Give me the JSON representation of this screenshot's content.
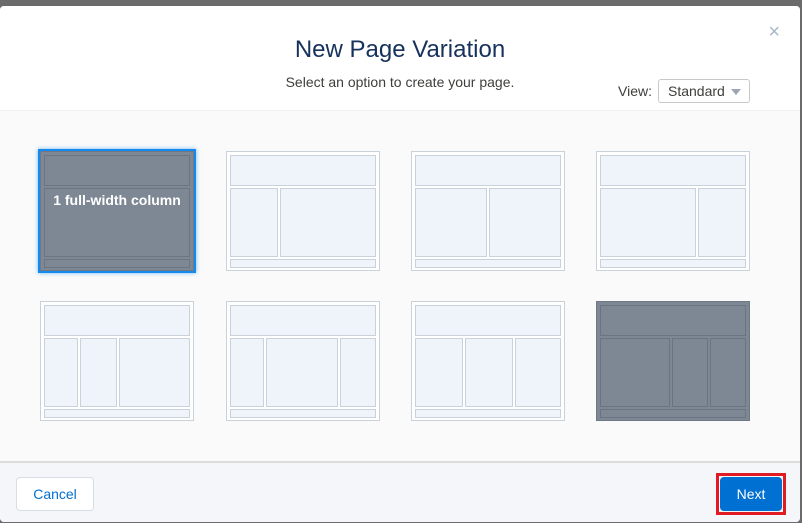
{
  "modal": {
    "title": "New Page Variation",
    "subtitle": "Select an option to create your page.",
    "close_glyph": "×"
  },
  "view": {
    "label": "View:",
    "selected": "Standard"
  },
  "templates": [
    {
      "name": "1 full-width column",
      "selected": true
    },
    {
      "name": "",
      "selected": false
    },
    {
      "name": "",
      "selected": false
    },
    {
      "name": "",
      "selected": false
    },
    {
      "name": "",
      "selected": false
    },
    {
      "name": "",
      "selected": false
    },
    {
      "name": "",
      "selected": false
    },
    {
      "name": "",
      "selected": false
    }
  ],
  "footer": {
    "cancel_label": "Cancel",
    "next_label": "Next"
  },
  "colors": {
    "primary": "#0070d2",
    "highlight": "#e01b24",
    "tile_dark": "#7e8895",
    "tile_light": "#eef4f9"
  }
}
